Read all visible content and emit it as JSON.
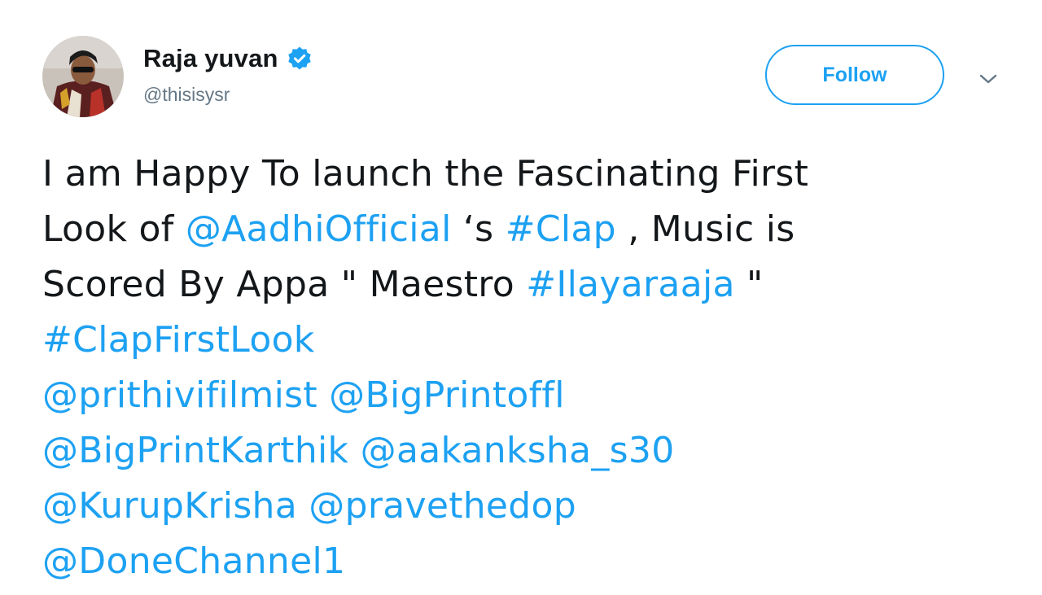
{
  "user": {
    "display_name": "Raja yuvan",
    "handle": "@thisisysr",
    "verified": true
  },
  "follow_button": {
    "label": "Follow"
  },
  "caret_icon": "chevron-down-icon",
  "tweet": {
    "segments": {
      "t1": "I am Happy To launch the Fascinating First",
      "t2": "Look of ",
      "mention_aadhi": "@AadhiOfficial",
      "t3": " ‘s ",
      "hashtag_clap": "#Clap",
      "t4": " , Music is",
      "t5": "Scored By Appa \" Maestro ",
      "hashtag_ilayaraaja": "#Ilayaraaja",
      "t6": " \"",
      "hashtag_clapfirstlook": "#ClapFirstLook",
      "mention_prithivi": "@prithivifilmist",
      "mention_bigprintoffl": "@BigPrintoffl",
      "mention_bigprintkarthik": "@BigPrintKarthik",
      "mention_aakanksha": "@aakanksha_s30",
      "mention_kurupkrisha": "@KurupKrisha",
      "mention_pravethedop": "@pravethedop",
      "mention_donechannel": "@DoneChannel1"
    }
  },
  "colors": {
    "link": "#1da1f2",
    "text": "#14171a",
    "handle": "#657786"
  }
}
